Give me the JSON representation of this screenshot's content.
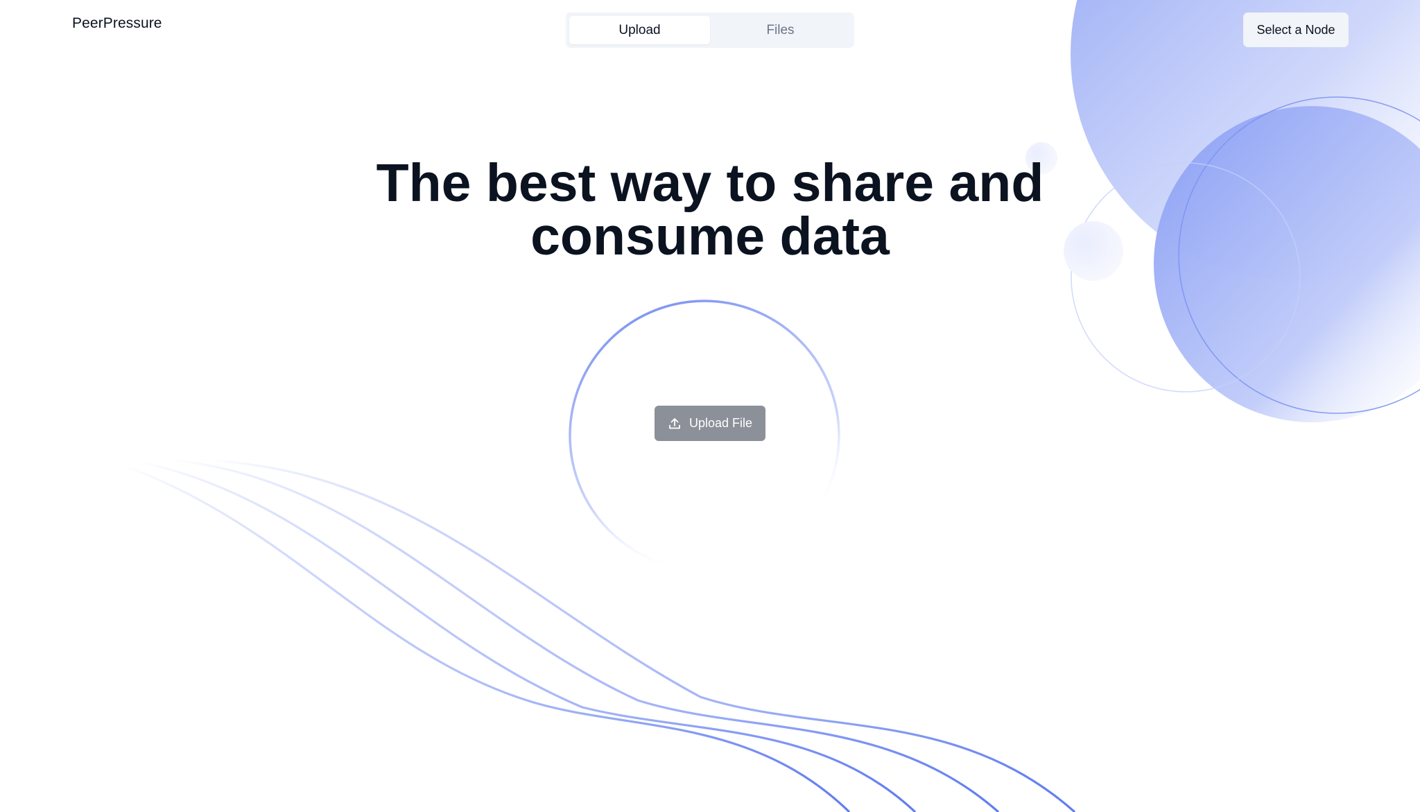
{
  "header": {
    "brand": "PeerPressure",
    "tabs": [
      {
        "label": "Upload",
        "active": true
      },
      {
        "label": "Files",
        "active": false
      }
    ],
    "node_button_label": "Select a Node"
  },
  "hero": {
    "title": "The best way to share and consume data"
  },
  "upload": {
    "button_label": "Upload File",
    "icon": "upload-icon"
  },
  "theme": {
    "accent": "#6b85f0",
    "text": "#0b1220",
    "muted_text": "#6b7587",
    "surface": "#f1f4f8",
    "button_gray": "#8b9099"
  }
}
